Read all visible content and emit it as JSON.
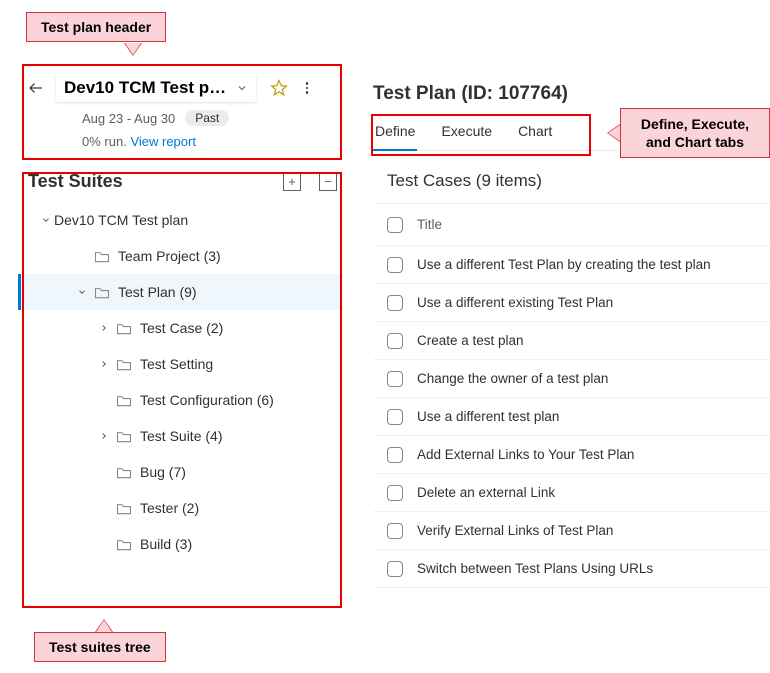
{
  "callouts": {
    "plan_header": "Test plan header",
    "tabs": "Define, Execute, and Chart tabs",
    "suites_tree": "Test suites tree"
  },
  "header": {
    "plan_name": "Dev10 TCM Test pl...",
    "date_range": "Aug 23 - Aug 30",
    "status_badge": "Past",
    "progress_text": "0% run.",
    "view_report": "View report"
  },
  "suites": {
    "title": "Test Suites",
    "tree": [
      {
        "label": "Dev10 TCM Test plan",
        "indent": 0,
        "chevron": "down",
        "icon": false
      },
      {
        "label": "Team Project (3)",
        "indent": 1,
        "chevron": "",
        "icon": true
      },
      {
        "label": "Test Plan (9)",
        "indent": 2,
        "chevron": "down",
        "icon": true,
        "selected": true
      },
      {
        "label": "Test Case (2)",
        "indent": 3,
        "chevron": "right",
        "icon": true
      },
      {
        "label": "Test Setting",
        "indent": 3,
        "chevron": "right",
        "icon": true
      },
      {
        "label": "Test Configuration (6)",
        "indent": 3,
        "chevron": "",
        "icon": true
      },
      {
        "label": "Test Suite (4)",
        "indent": 3,
        "chevron": "right",
        "icon": true
      },
      {
        "label": "Bug (7)",
        "indent": 3,
        "chevron": "",
        "icon": true
      },
      {
        "label": "Tester (2)",
        "indent": 3,
        "chevron": "",
        "icon": true
      },
      {
        "label": "Build (3)",
        "indent": 3,
        "chevron": "",
        "icon": true
      }
    ]
  },
  "right": {
    "title": "Test Plan (ID: 107764)",
    "tabs": {
      "define": "Define",
      "execute": "Execute",
      "chart": "Chart"
    },
    "cases_title": "Test Cases (9 items)",
    "column_title": "Title",
    "cases": [
      "Use a different Test Plan by creating the test plan",
      "Use a different existing Test Plan",
      "Create a test plan",
      "Change the owner of a test plan",
      "Use a different test plan",
      "Add External Links to Your Test Plan",
      "Delete an external Link",
      "Verify External Links of Test Plan",
      "Switch between Test Plans Using URLs"
    ]
  }
}
